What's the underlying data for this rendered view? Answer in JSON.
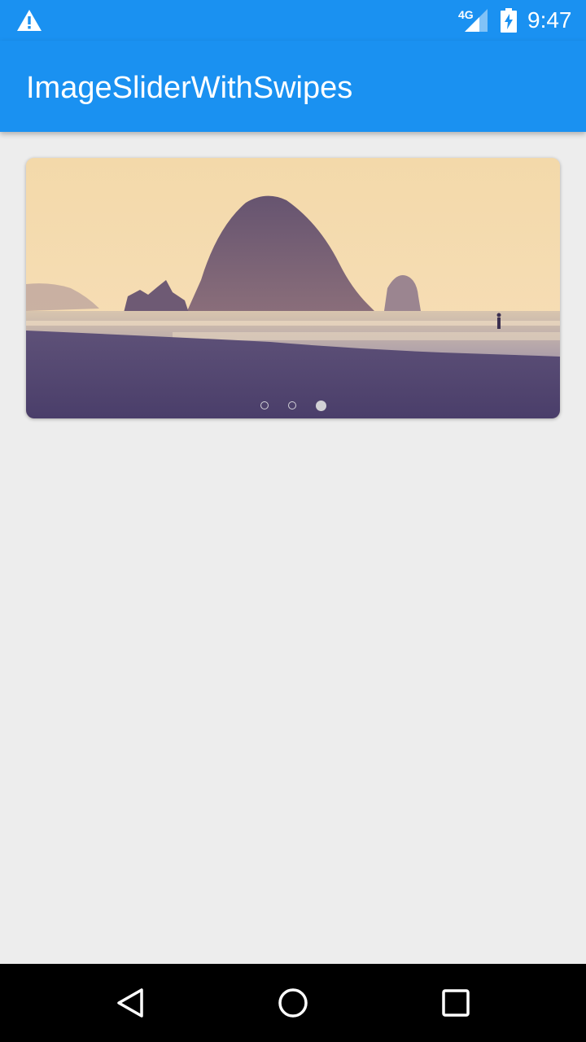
{
  "status_bar": {
    "time": "9:47",
    "network_label": "4G",
    "icons": [
      "warning-icon",
      "signal-icon",
      "battery-charging-icon"
    ]
  },
  "app_bar": {
    "title": "ImageSliderWithSwipes"
  },
  "slider": {
    "image": "coastal-sea-stack-beach-photo",
    "slide_count": 3,
    "active_slide": 3
  },
  "nav_bar": {
    "buttons": [
      "back-icon",
      "home-icon",
      "recents-icon"
    ]
  },
  "colors": {
    "primary": "#1A91F1",
    "background": "#EDEDED",
    "nav_bar": "#000000"
  }
}
